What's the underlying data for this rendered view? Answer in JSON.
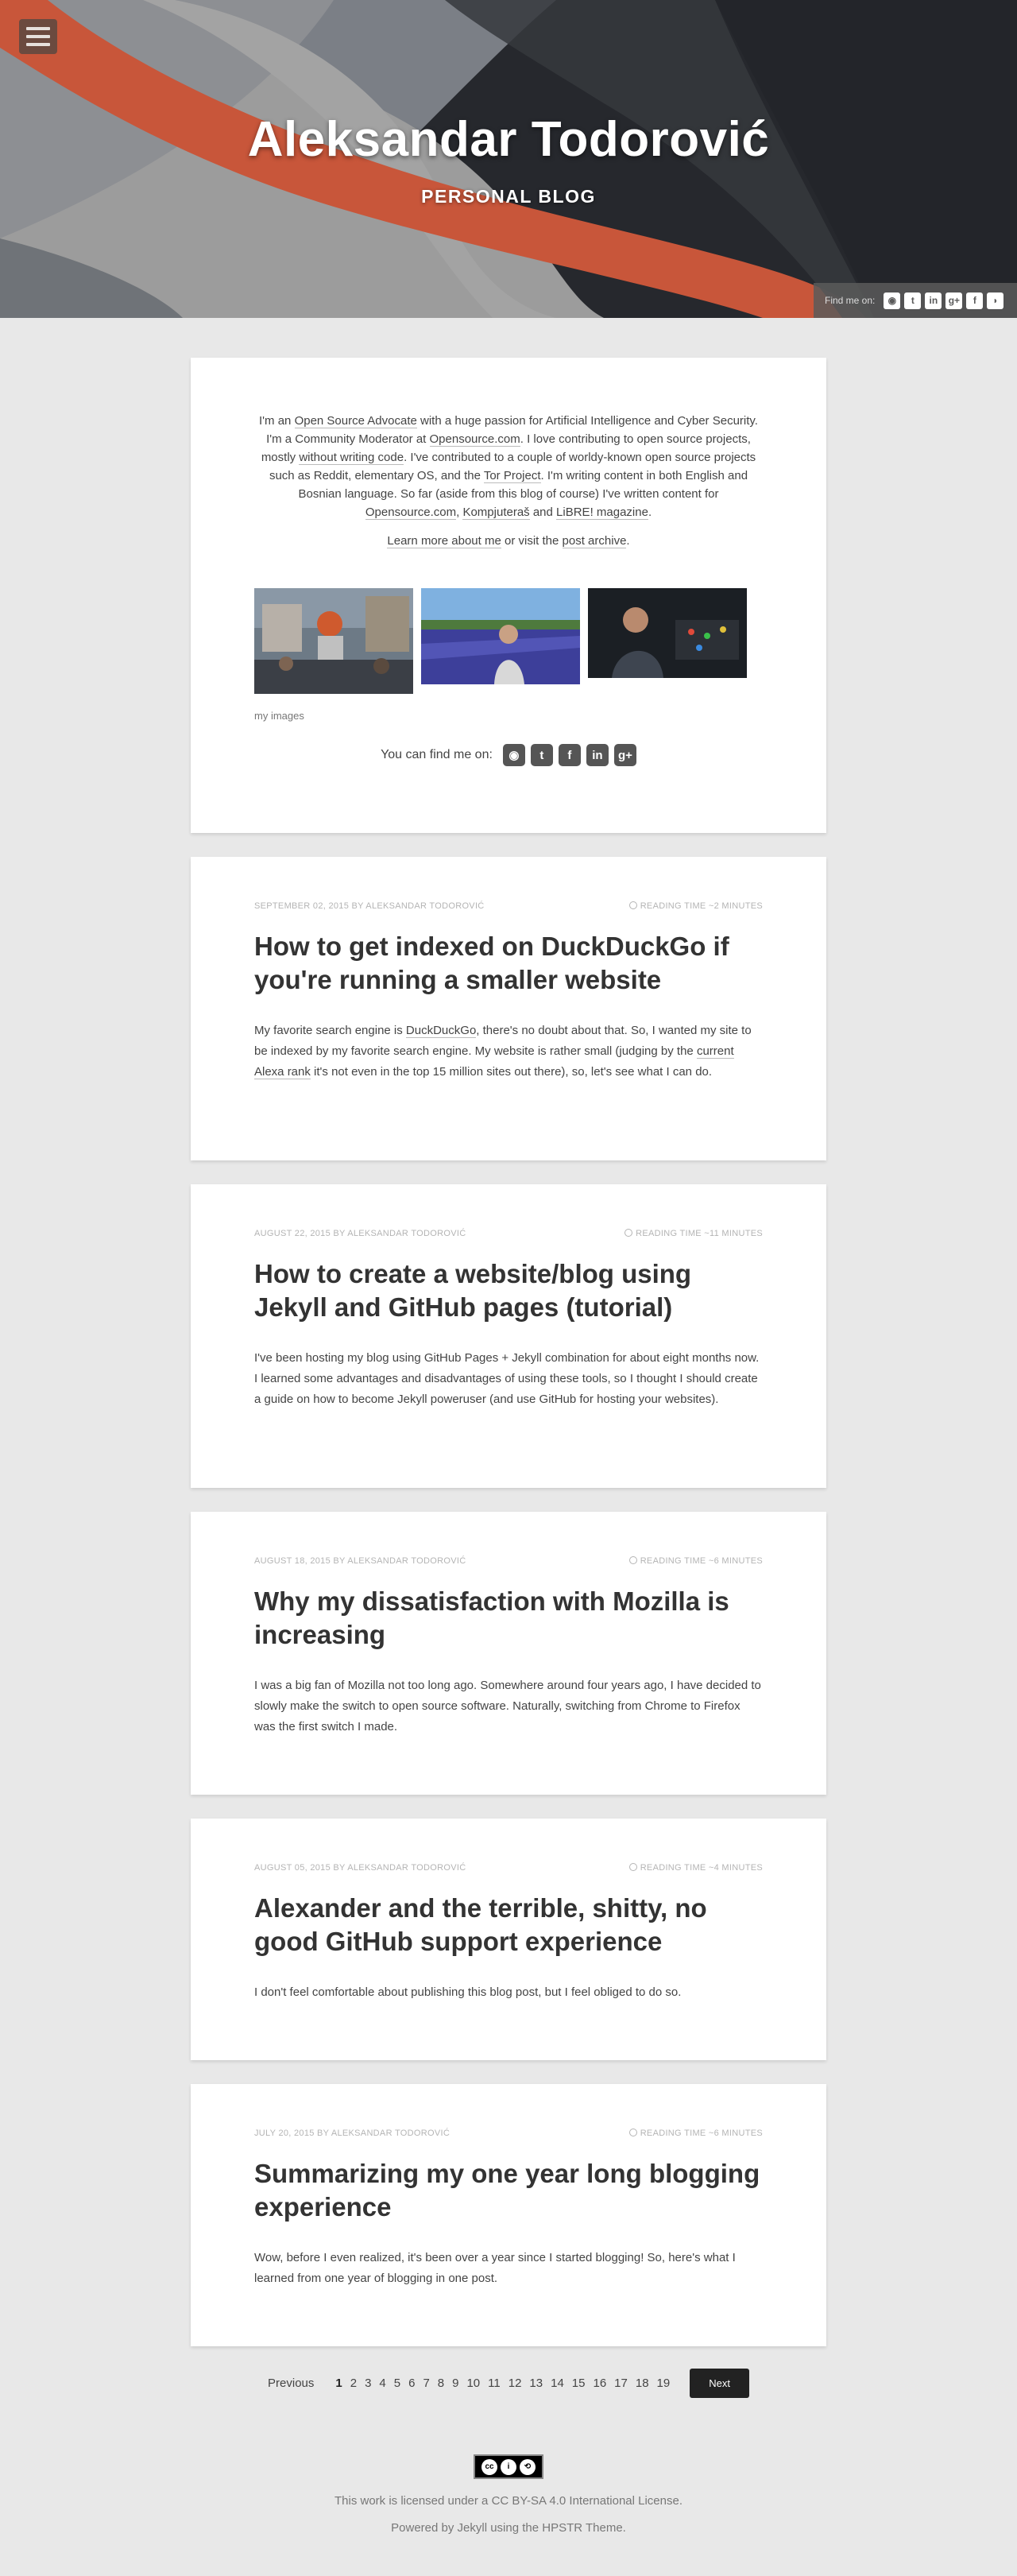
{
  "header": {
    "title": "Aleksandar Todorović",
    "tagline": "PERSONAL BLOG",
    "find_me_label": "Find me on:",
    "social_icons": [
      "github-icon",
      "twitter-icon",
      "linkedin-icon",
      "google-plus-icon",
      "facebook-icon",
      "rss-icon"
    ]
  },
  "intro": {
    "bio_1": "I'm an ",
    "bio_link_1": "Open Source Advocate",
    "bio_2": " with a huge passion for Artificial Intelligence and Cyber Security. I'm a Community Moderator at ",
    "bio_link_2": "Opensource.com",
    "bio_3": ". I love contributing to open source projects, mostly ",
    "bio_link_3": "without writing code",
    "bio_4": ". I've contributed to a couple of worldy-known open source projects such as Reddit, elementary OS, and the ",
    "bio_link_4": "Tor Project",
    "bio_5": ". I'm writing content in both English and Bosnian language. So far (aside from this blog of course) I've written content for ",
    "bio_link_5": "Opensource.com",
    "bio_6": ", ",
    "bio_link_6": "Kompjuteraš",
    "bio_7": " and ",
    "bio_link_7": "LiBRE! magazine",
    "bio_8": ".",
    "more_link_1": "Learn more about me",
    "more_mid": " or visit the ",
    "more_link_2": "post archive",
    "more_end": ".",
    "images_caption": "my images",
    "find_me_label": "You can find me on:",
    "social_icons": [
      "github-icon",
      "twitter-icon",
      "facebook-icon",
      "linkedin-icon",
      "google-plus-icon"
    ]
  },
  "posts": [
    {
      "meta_left": "SEPTEMBER 02, 2015 BY ALEKSANDAR TODOROVIĆ",
      "meta_right": "READING TIME ~2 MINUTES",
      "title": "How to get indexed on DuckDuckGo if you're running a smaller website",
      "excerpt_1": "My favorite search engine is ",
      "excerpt_link_1": "DuckDuckGo",
      "excerpt_2": ", there's no doubt about that. So, I wanted my site to be indexed by my favorite search engine. My website is rather small (judging by the ",
      "excerpt_link_2": "current Alexa rank",
      "excerpt_3": " it's not even in the top 15 million sites out there), so, let's see what I can do."
    },
    {
      "meta_left": "AUGUST 22, 2015 BY ALEKSANDAR TODOROVIĆ",
      "meta_right": "READING TIME ~11 MINUTES",
      "title": "How to create a website/blog using Jekyll and GitHub pages (tutorial)",
      "excerpt_1": "I've been hosting my blog using GitHub Pages + Jekyll combination for about eight months now. I learned some advantages and disadvantages of using these tools, so I thought I should create a guide on how to become Jekyll poweruser (and use GitHub for hosting your websites)."
    },
    {
      "meta_left": "AUGUST 18, 2015 BY ALEKSANDAR TODOROVIĆ",
      "meta_right": "READING TIME ~6 MINUTES",
      "title": "Why my dissatisfaction with Mozilla is increasing",
      "excerpt_1": "I was a big fan of Mozilla not too long ago. Somewhere around four years ago, I have decided to slowly make the switch to open source software. Naturally, switching from Chrome to Firefox was the first switch I made."
    },
    {
      "meta_left": "AUGUST 05, 2015 BY ALEKSANDAR TODOROVIĆ",
      "meta_right": "READING TIME ~4 MINUTES",
      "title": "Alexander and the terrible, shitty, no good GitHub support experience",
      "excerpt_1": "I don't feel comfortable about publishing this blog post, but I feel obliged to do so."
    },
    {
      "meta_left": "JULY 20, 2015 BY ALEKSANDAR TODOROVIĆ",
      "meta_right": "READING TIME ~6 MINUTES",
      "title": "Summarizing my one year long blogging experience",
      "excerpt_1": "Wow, before I even realized, it's been over a year since I started blogging! So, here's what I learned from one year of blogging in one post."
    }
  ],
  "pagination": {
    "prev": "Previous",
    "pages": [
      "1",
      "2",
      "3",
      "4",
      "5",
      "6",
      "7",
      "8",
      "9",
      "10",
      "11",
      "12",
      "13",
      "14",
      "15",
      "16",
      "17",
      "18",
      "19"
    ],
    "current": "1",
    "next": "Next"
  },
  "footer": {
    "license_badge": "CC BY SA",
    "license_text": "This work is licensed under a CC BY-SA 4.0 International License.",
    "powered": "Powered by Jekyll using the HPSTR Theme."
  },
  "colors": {
    "accent_stripe": "#c8563a",
    "background": "#e8e8e8",
    "button_dark": "#222222"
  }
}
